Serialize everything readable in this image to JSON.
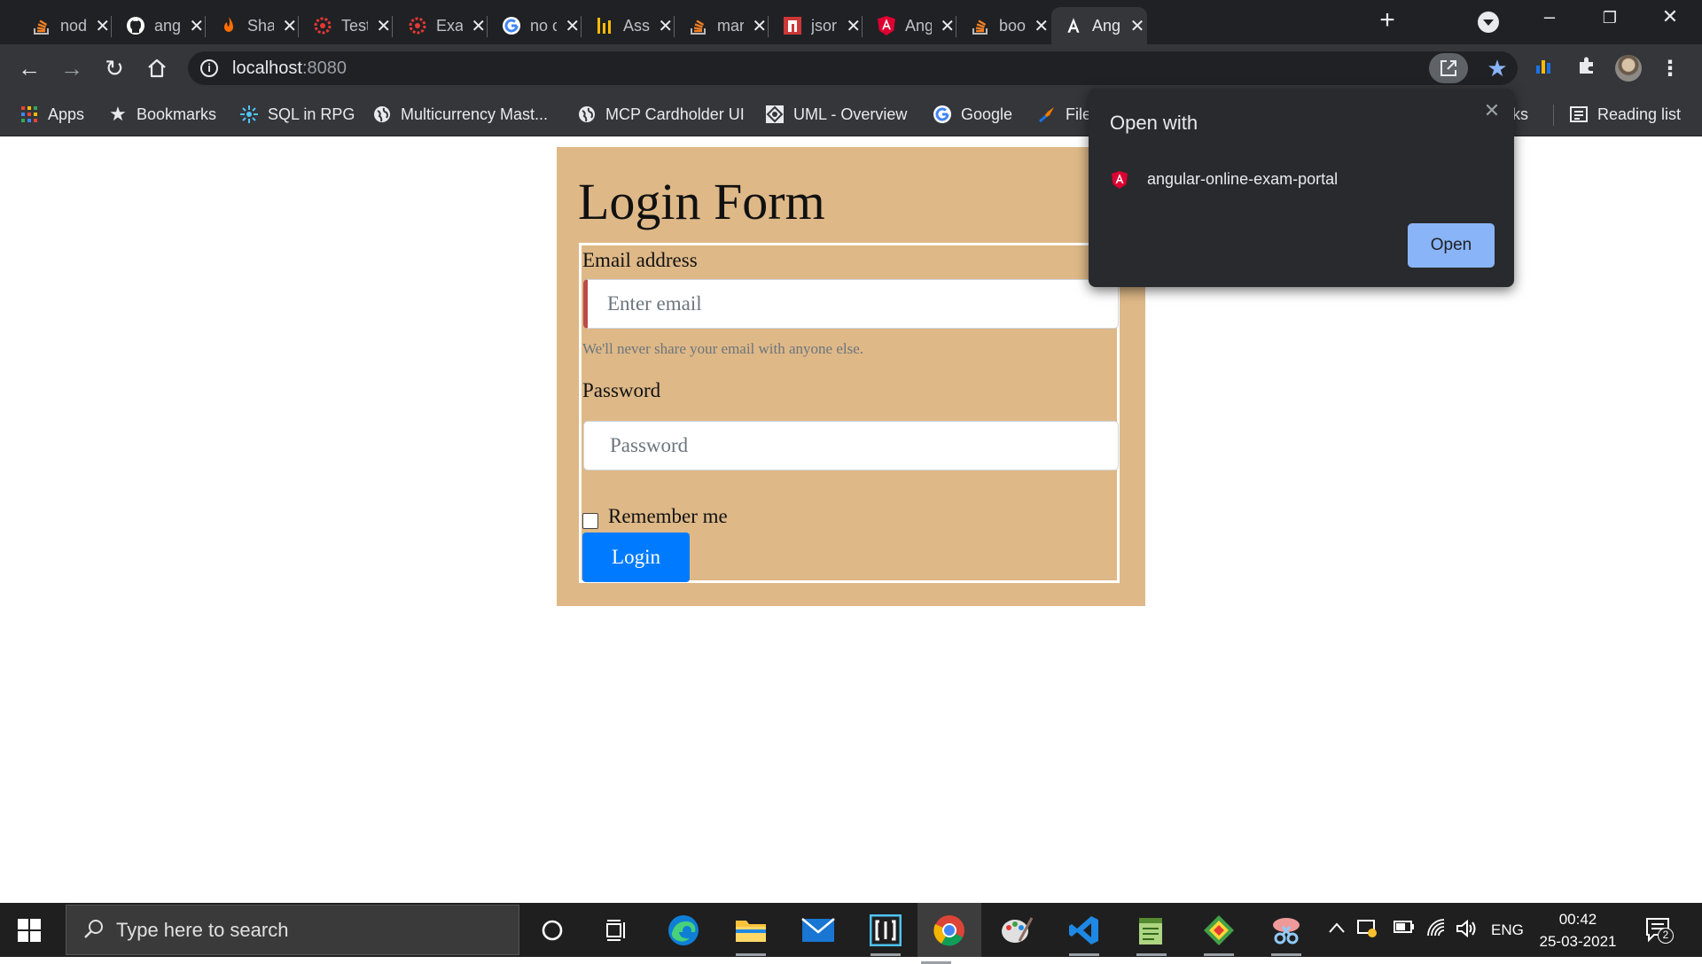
{
  "tabs": [
    {
      "title": "nod",
      "icon": "stackoverflow-icon"
    },
    {
      "title": "ang",
      "icon": "github-icon"
    },
    {
      "title": "Sha",
      "icon": "fire-icon"
    },
    {
      "title": "Test",
      "icon": "gear-red-icon"
    },
    {
      "title": "Exa",
      "icon": "gear-red-icon"
    },
    {
      "title": "no c",
      "icon": "google-icon"
    },
    {
      "title": "Ass",
      "icon": "bar-chart-icon"
    },
    {
      "title": "mar",
      "icon": "stackoverflow-icon"
    },
    {
      "title": "jsor",
      "icon": "npm-icon"
    },
    {
      "title": "Ang",
      "icon": "angular-icon"
    },
    {
      "title": "boo",
      "icon": "stackoverflow-icon"
    },
    {
      "title": "Ang",
      "icon": "angular-white-icon",
      "active": true
    }
  ],
  "toolbar": {
    "url_host": "localhost",
    "url_port": ":8080"
  },
  "bookmarks": {
    "items": [
      {
        "label": "Apps",
        "icon": "apps-grid-icon"
      },
      {
        "label": "Bookmarks",
        "icon": "star-icon"
      },
      {
        "label": "SQL in RPG",
        "icon": "sparkle-icon"
      },
      {
        "label": "Multicurrency Mast...",
        "icon": "globe-icon"
      },
      {
        "label": "MCP Cardholder UI",
        "icon": "globe-icon"
      },
      {
        "label": "UML - Overview",
        "icon": "uml-icon"
      },
      {
        "label": "Google",
        "icon": "google-icon"
      },
      {
        "label": "File",
        "icon": "file-icon"
      }
    ],
    "other_partial": "rks",
    "reading_list": "Reading list"
  },
  "page": {
    "title": "Login Form",
    "email_label": "Email address",
    "email_placeholder": "Enter email",
    "email_value": "",
    "email_help": "We'll never share your email with anyone else.",
    "password_label": "Password",
    "password_placeholder": "Password",
    "password_value": "",
    "remember_label": "Remember me",
    "remember_checked": false,
    "login_button": "Login",
    "card_color": "#deb887",
    "button_color": "#007bff"
  },
  "popup": {
    "title": "Open with",
    "app_name": "angular-online-exam-portal",
    "open_button": "Open"
  },
  "taskbar": {
    "search_placeholder": "Type here to search",
    "language": "ENG",
    "time": "00:42",
    "date": "25-03-2021",
    "notifications": "2"
  }
}
